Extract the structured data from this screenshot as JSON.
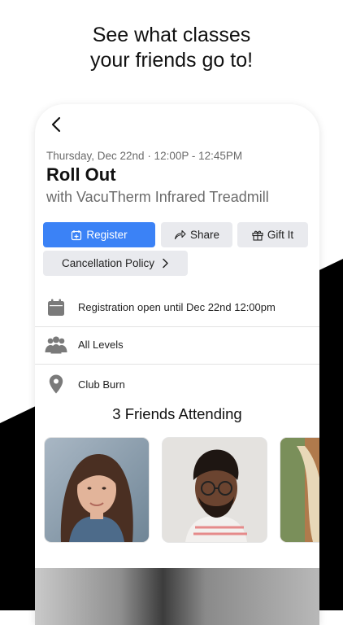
{
  "headline": {
    "line1": "See what classes",
    "line2": "your friends go to!"
  },
  "class_detail": {
    "datetime": "Thursday, Dec 22nd · 12:00P - 12:45PM",
    "title": "Roll Out",
    "subtitle": "with VacuTherm Infrared Treadmill"
  },
  "actions": {
    "register_label": "Register",
    "share_label": "Share",
    "gift_label": "Gift It",
    "policy_label": "Cancellation Policy"
  },
  "info": {
    "registration": "Registration open until Dec 22nd 12:00pm",
    "levels": "All Levels",
    "location": "Club Burn"
  },
  "friends": {
    "title": "3 Friends Attending"
  },
  "colors": {
    "accent": "#3b82f6",
    "icon_gray": "#7a7a7a",
    "background_black": "#000000"
  },
  "icons": {
    "back": "chevron-left-icon",
    "register": "calendar-plus-icon",
    "share": "share-arrow-icon",
    "gift": "gift-icon",
    "policy": "chevron-right-icon",
    "registration": "calendar-icon",
    "levels": "group-icon",
    "location": "location-pin-icon"
  }
}
